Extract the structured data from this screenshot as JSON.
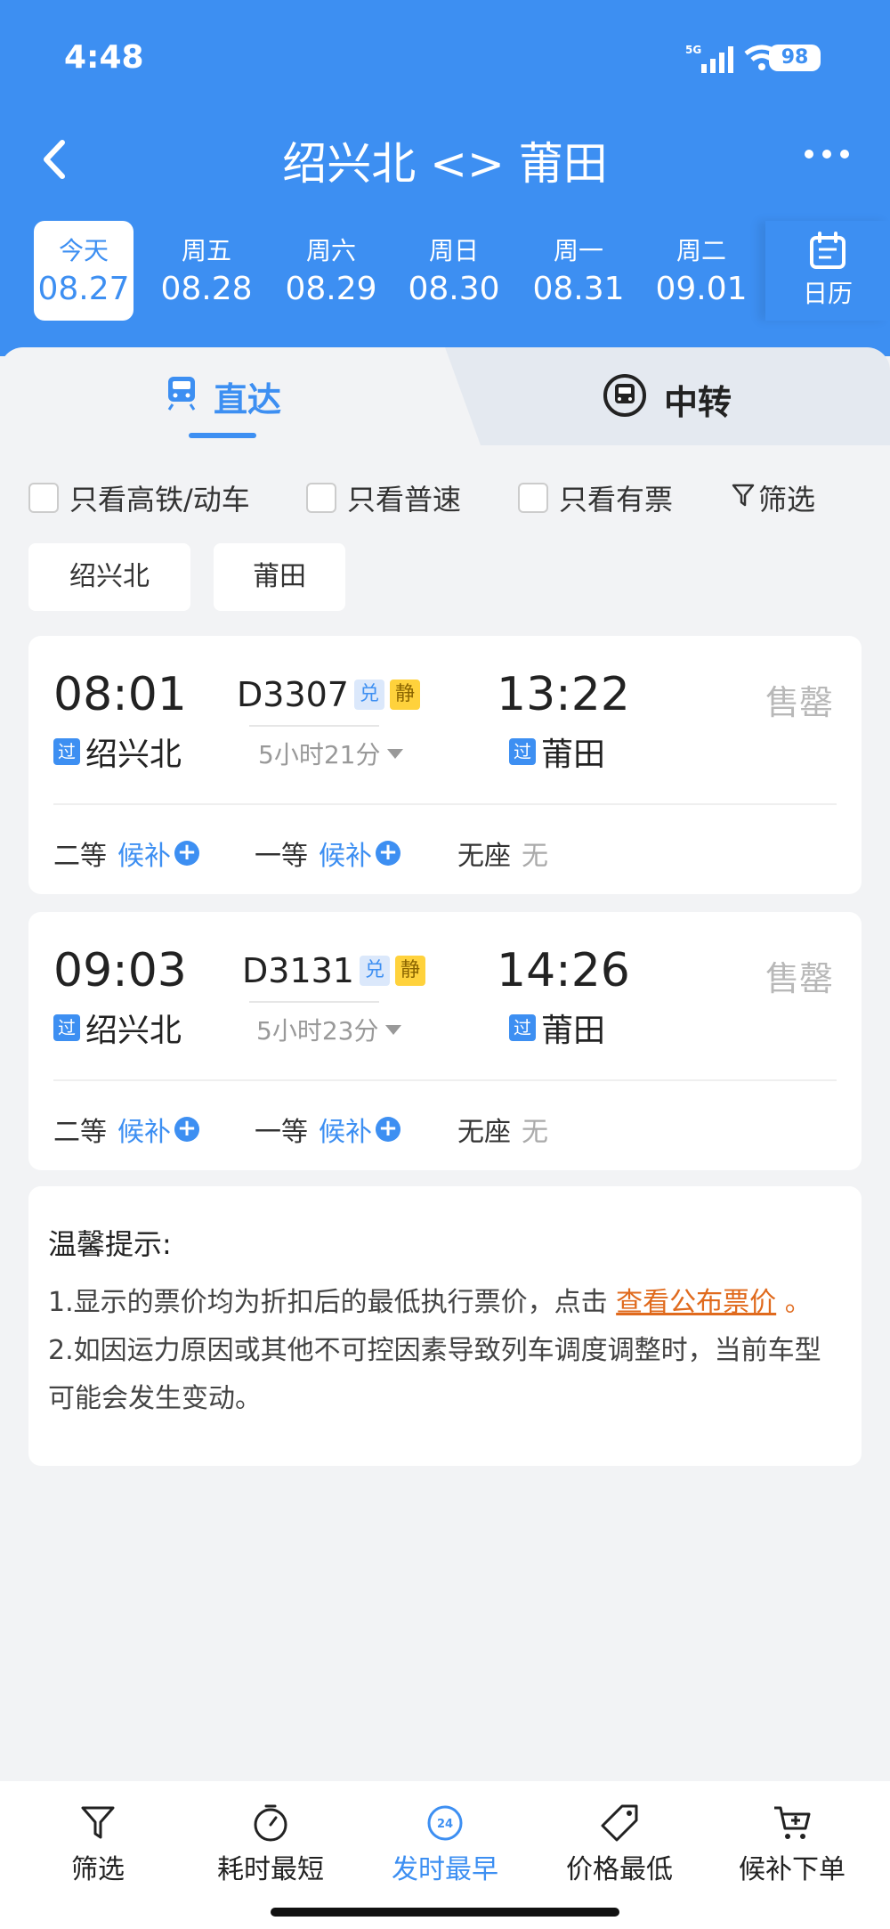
{
  "status": {
    "time": "4:48",
    "signal": "5G",
    "battery": "98"
  },
  "nav": {
    "title": "绍兴北 <> 莆田"
  },
  "dates": [
    {
      "weekday": "今天",
      "date": "08.27",
      "active": true
    },
    {
      "weekday": "周五",
      "date": "08.28"
    },
    {
      "weekday": "周六",
      "date": "08.29"
    },
    {
      "weekday": "周日",
      "date": "08.30"
    },
    {
      "weekday": "周一",
      "date": "08.31"
    },
    {
      "weekday": "周二",
      "date": "09.01"
    }
  ],
  "calendar_label": "日历",
  "tabs": {
    "direct": "直达",
    "transfer": "中转"
  },
  "filters": {
    "highspeed": "只看高铁/动车",
    "normal": "只看普速",
    "available": "只看有票",
    "filter": "筛选"
  },
  "station_tags": [
    "绍兴北",
    "莆田"
  ],
  "trains": [
    {
      "dep_time": "08:01",
      "arr_time": "13:22",
      "train_no": "D3307",
      "badge_dui": "兑",
      "badge_jing": "静",
      "dep_station": "绍兴北",
      "arr_station": "莆田",
      "pass_tag": "过",
      "duration": "5小时21分",
      "status": "售罄",
      "seats": [
        {
          "class": "二等",
          "value": "候补"
        },
        {
          "class": "一等",
          "value": "候补"
        },
        {
          "class": "无座",
          "value": "无"
        }
      ]
    },
    {
      "dep_time": "09:03",
      "arr_time": "14:26",
      "train_no": "D3131",
      "badge_dui": "兑",
      "badge_jing": "静",
      "dep_station": "绍兴北",
      "arr_station": "莆田",
      "pass_tag": "过",
      "duration": "5小时23分",
      "status": "售罄",
      "seats": [
        {
          "class": "二等",
          "value": "候补"
        },
        {
          "class": "一等",
          "value": "候补"
        },
        {
          "class": "无座",
          "value": "无"
        }
      ]
    }
  ],
  "notice": {
    "title": "温馨提示:",
    "line1_prefix": "1.显示的票价均为折扣后的最低执行票价，点击",
    "line1_link": "查看公布票价",
    "line1_suffix": "。",
    "line2": "2.如因运力原因或其他不可控因素导致列车调度调整时，当前车型可能会发生变动。"
  },
  "bottom_bar": [
    {
      "label": "筛选",
      "icon": "filter-icon"
    },
    {
      "label": "耗时最短",
      "icon": "timer-icon"
    },
    {
      "label": "发时最早",
      "icon": "clock-24-icon",
      "active": true
    },
    {
      "label": "价格最低",
      "icon": "price-tag-icon"
    },
    {
      "label": "候补下单",
      "icon": "cart-icon"
    }
  ],
  "colors": {
    "primary": "#3d8ff2",
    "link": "#e06a1d",
    "sold_out": "#b8b8b8"
  }
}
